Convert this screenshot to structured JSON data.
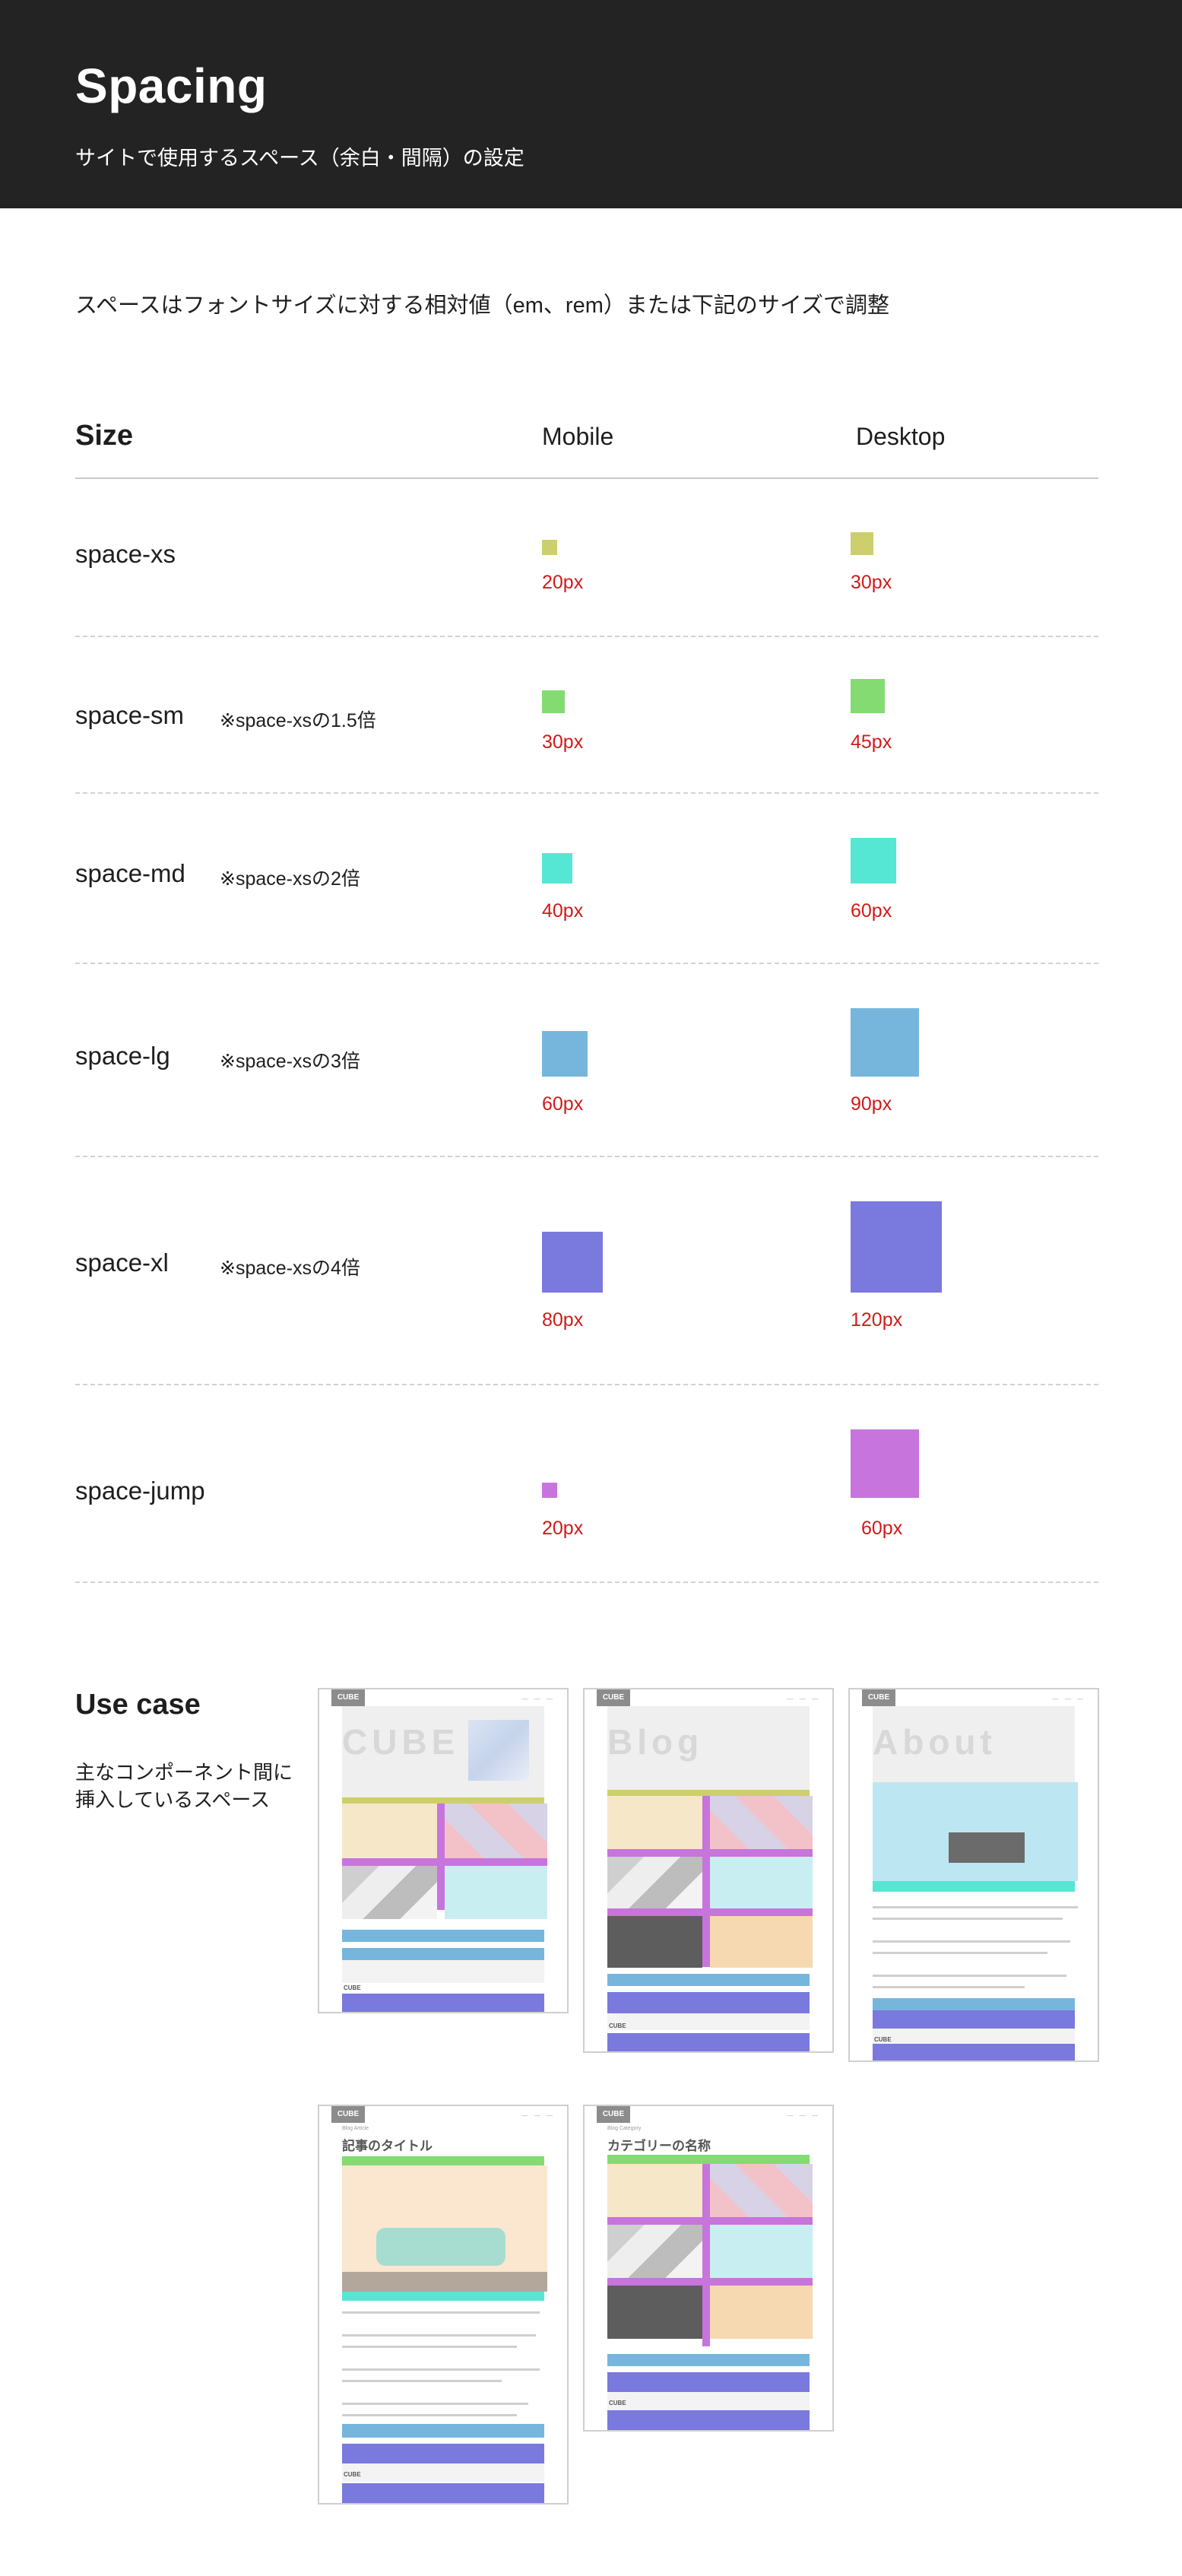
{
  "header": {
    "title": "Spacing",
    "subtitle": "サイトで使用するスペース（余白・間隔）の設定"
  },
  "intro": "スペースはフォントサイズに対する相対値（em、rem）または下記のサイズで調整",
  "table": {
    "col_size": "Size",
    "col_mobile": "Mobile",
    "col_desktop": "Desktop",
    "rows": [
      {
        "name": "space-xs",
        "note": "",
        "mobile": "20px",
        "desktop": "30px",
        "color": "#cccf6c"
      },
      {
        "name": "space-sm",
        "note": "※space-xsの1.5倍",
        "mobile": "30px",
        "desktop": "45px",
        "color": "#84db72"
      },
      {
        "name": "space-md",
        "note": "※space-xsの2倍",
        "mobile": "40px",
        "desktop": "60px",
        "color": "#56e6d4"
      },
      {
        "name": "space-lg",
        "note": "※space-xsの3倍",
        "mobile": "60px",
        "desktop": "90px",
        "color": "#76b6dc"
      },
      {
        "name": "space-xl",
        "note": "※space-xsの4倍",
        "mobile": "80px",
        "desktop": "120px",
        "color": "#7a79dd"
      },
      {
        "name": "space-jump",
        "note": "",
        "mobile": "20px",
        "desktop": "60px",
        "color": "#c774dd"
      }
    ]
  },
  "usecase": {
    "title": "Use case",
    "description_line1": "主なコンポーネント間に",
    "description_line2": "挿入しているスペース",
    "thumbnails": [
      {
        "logo": "CUBE",
        "hero_title": "CUBE",
        "footer": "CUBE"
      },
      {
        "logo": "CUBE",
        "hero_title": "Blog",
        "footer": "CUBE"
      },
      {
        "logo": "CUBE",
        "hero_title": "About",
        "footer": "CUBE"
      },
      {
        "logo": "CUBE",
        "page_title": "記事のタイトル",
        "page_sub": "Blog Article",
        "footer": "CUBE"
      },
      {
        "logo": "CUBE",
        "page_title": "カテゴリーの名称",
        "page_sub": "Blog Category",
        "footer": "CUBE"
      }
    ]
  },
  "colors": {
    "header_bg": "#232323",
    "size_label": "#d21a1a",
    "xs": "#cccf6c",
    "sm": "#84db72",
    "md": "#56e6d4",
    "lg": "#76b6dc",
    "xl": "#7a79dd",
    "jump": "#c774dd"
  }
}
